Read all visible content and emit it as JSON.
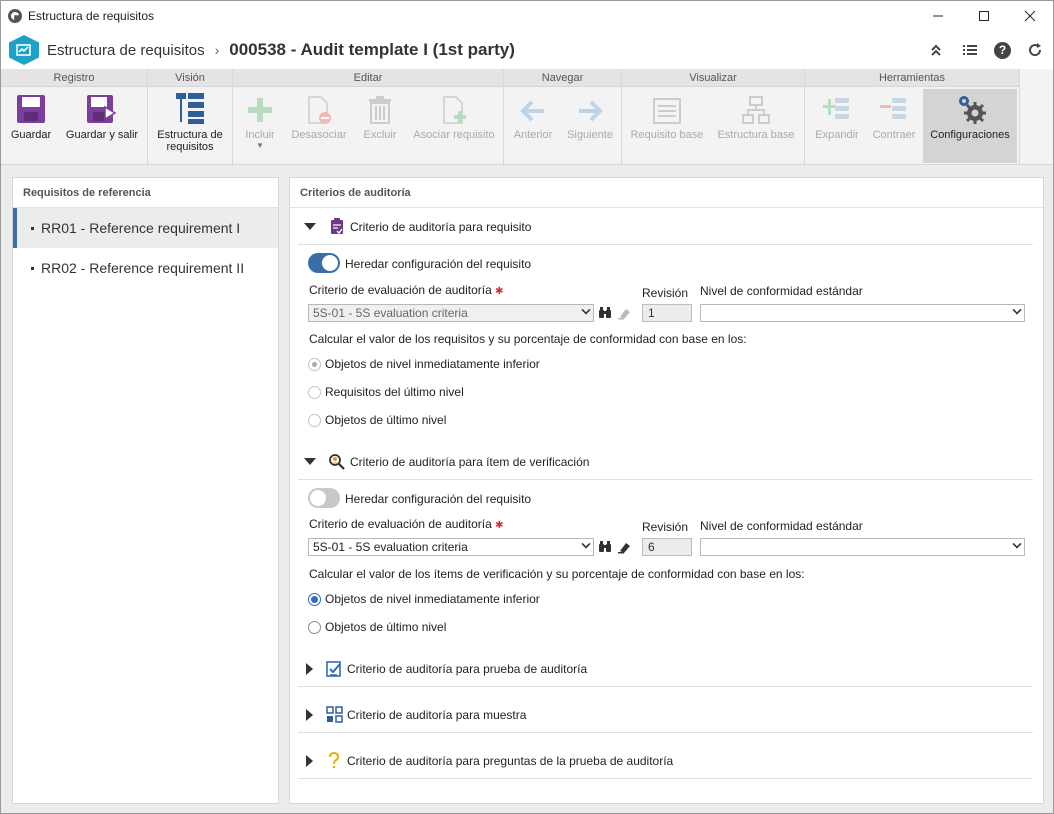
{
  "window": {
    "title": "Estructura de requisitos"
  },
  "header": {
    "breadcrumb_parent": "Estructura de requisitos",
    "breadcrumb_separator": "›",
    "breadcrumb_current": "000538 - Audit template I (1st party)"
  },
  "ribbon": {
    "groups": [
      "Registro",
      "Visión",
      "Editar",
      "Navegar",
      "Visualizar",
      "Herramientas"
    ],
    "buttons": {
      "save": "Guardar",
      "save_exit": "Guardar y salir",
      "structure": "Estructura de requisitos",
      "include": "Incluir",
      "disassociate": "Desasociar",
      "delete": "Excluir",
      "associate": "Asociar requisito",
      "previous": "Anterior",
      "next": "Siguiente",
      "base_req": "Requisito base",
      "base_struct": "Estructura base",
      "expand": "Expandir",
      "collapse": "Contraer",
      "settings": "Configuraciones"
    }
  },
  "left": {
    "title": "Requisitos de referencia",
    "items": [
      "RR01 - Reference requirement I",
      "RR02 - Reference requirement II"
    ]
  },
  "right": {
    "title": "Criterios de auditoría",
    "s1": {
      "title": "Criterio de auditoría para requisito",
      "toggle_label": "Heredar configuración del requisito",
      "criteria_label": "Criterio de evaluación de auditoría",
      "criteria_value": "5S-01 - 5S evaluation criteria",
      "revision_label": "Revisión",
      "revision_value": "1",
      "level_label": "Nivel de conformidad estándar",
      "level_value": "",
      "calc_text": "Calcular el valor de los requisitos y su porcentaje de conformidad con base en los:",
      "options": [
        "Objetos de nivel inmediatamente inferior",
        "Requisitos del último nivel",
        "Objetos de último nivel"
      ]
    },
    "s2": {
      "title": "Criterio de auditoría para ítem de verificación",
      "toggle_label": "Heredar configuración del requisito",
      "criteria_label": "Criterio de evaluación de auditoría",
      "criteria_value": "5S-01 - 5S evaluation criteria",
      "revision_label": "Revisión",
      "revision_value": "6",
      "level_label": "Nivel de conformidad estándar",
      "level_value": "",
      "calc_text": "Calcular el valor de los ítems de verificación y su porcentaje de conformidad con base en los:",
      "options": [
        "Objetos de nivel inmediatamente inferior",
        "Objetos de último nivel"
      ]
    },
    "s3": {
      "title": "Criterio de auditoría para prueba de auditoría"
    },
    "s4": {
      "title": "Criterio de auditoría para muestra"
    },
    "s5": {
      "title": "Criterio de auditoría para preguntas de la prueba de auditoría"
    }
  },
  "colors": {
    "accent": "#3a6ea8",
    "logo": "#1ca1c9",
    "purple": "#7b3f99",
    "required": "#e0223b"
  }
}
